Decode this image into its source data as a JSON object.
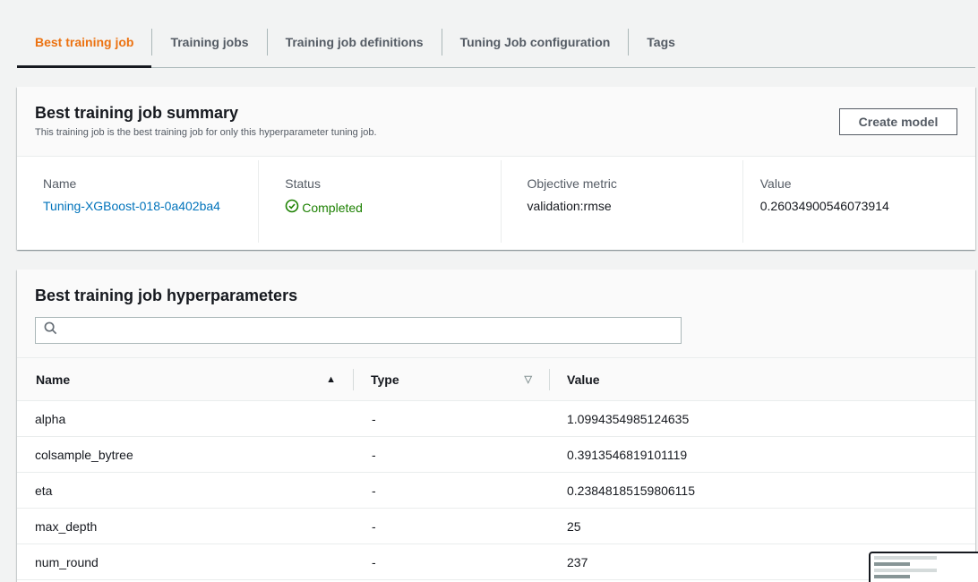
{
  "tabs": [
    {
      "label": "Best training job",
      "active": true
    },
    {
      "label": "Training jobs"
    },
    {
      "label": "Training job definitions"
    },
    {
      "label": "Tuning Job configuration"
    },
    {
      "label": "Tags"
    }
  ],
  "summary": {
    "title": "Best training job summary",
    "description": "This training job is the best training job for only this hyperparameter tuning job.",
    "create_label": "Create model",
    "name_label": "Name",
    "name_value": "Tuning-XGBoost-018-0a402ba4",
    "status_label": "Status",
    "status_value": "Completed",
    "metric_label": "Objective metric",
    "metric_value": "validation:rmse",
    "value_label": "Value",
    "value_value": "0.26034900546073914"
  },
  "hyperparameters": {
    "title": "Best training job hyperparameters",
    "search_placeholder": "",
    "columns": [
      "Name",
      "Type",
      "Value"
    ],
    "rows": [
      {
        "name": "alpha",
        "type": "-",
        "value": "1.0994354985124635"
      },
      {
        "name": "colsample_bytree",
        "type": "-",
        "value": "0.3913546819101119"
      },
      {
        "name": "eta",
        "type": "-",
        "value": "0.23848185159806115"
      },
      {
        "name": "max_depth",
        "type": "-",
        "value": "25"
      },
      {
        "name": "num_round",
        "type": "-",
        "value": "237"
      }
    ]
  },
  "colors": {
    "accent": "#ec7211",
    "link": "#0073bb",
    "success": "#1d8102"
  }
}
